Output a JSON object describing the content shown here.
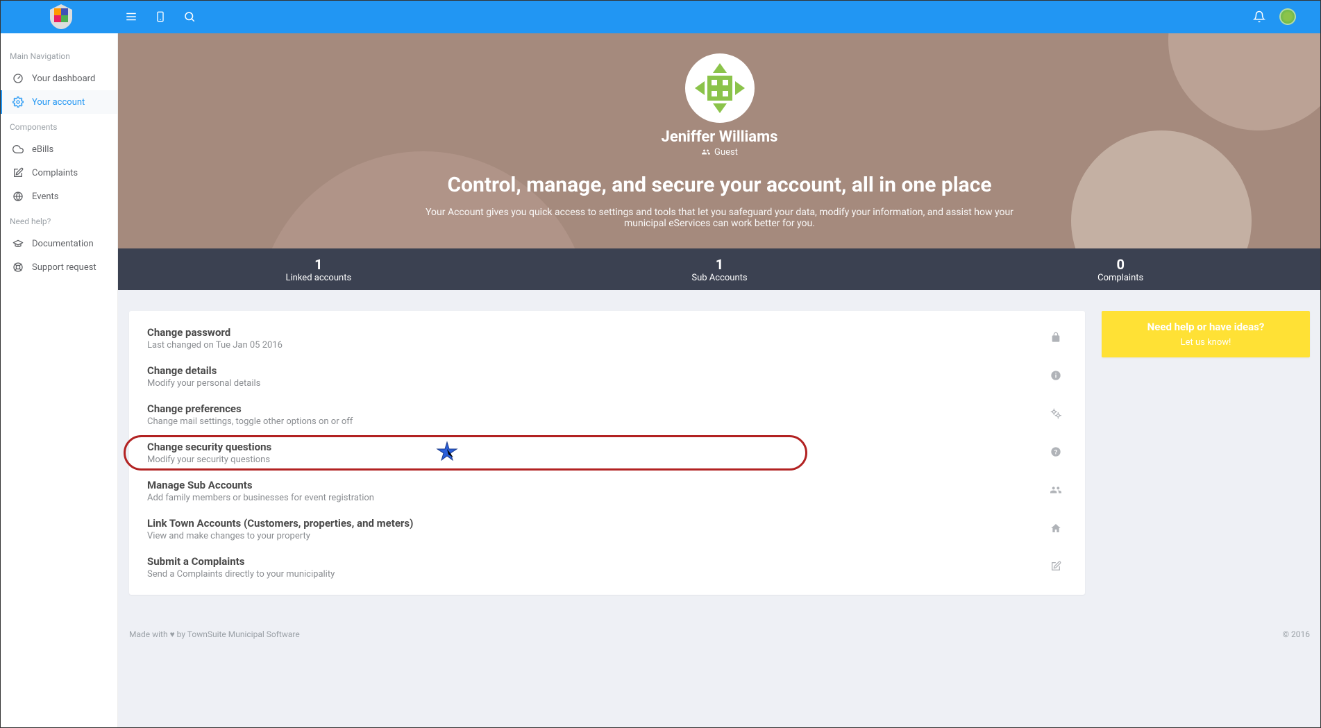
{
  "topbar": {
    "icons": [
      "menu",
      "mobile",
      "search"
    ],
    "right_icons": [
      "bell"
    ]
  },
  "sidebar": {
    "sections": [
      {
        "heading": "Main Navigation",
        "items": [
          {
            "label": "Your dashboard",
            "icon": "gauge",
            "active": false
          },
          {
            "label": "Your account",
            "icon": "gear",
            "active": true
          }
        ]
      },
      {
        "heading": "Components",
        "items": [
          {
            "label": "eBills",
            "icon": "cloud",
            "active": false
          },
          {
            "label": "Complaints",
            "icon": "edit",
            "active": false
          },
          {
            "label": "Events",
            "icon": "calendar-globe",
            "active": false
          }
        ]
      },
      {
        "heading": "Need help?",
        "items": [
          {
            "label": "Documentation",
            "icon": "grad-cap",
            "active": false
          },
          {
            "label": "Support request",
            "icon": "lifebuoy",
            "active": false
          }
        ]
      }
    ]
  },
  "hero": {
    "name": "Jeniffer Williams",
    "role": "Guest",
    "title": "Control, manage, and secure your account, all in one place",
    "subtitle": "Your Account gives you quick access to settings and tools that let you safeguard your data, modify your information, and assist how your municipal eServices can work better for you."
  },
  "stats": [
    {
      "value": "1",
      "label": "Linked accounts"
    },
    {
      "value": "1",
      "label": "Sub Accounts"
    },
    {
      "value": "0",
      "label": "Complaints"
    }
  ],
  "options": [
    {
      "title": "Change password",
      "desc": "Last changed on Tue Jan 05 2016",
      "icon": "lock",
      "highlighted": false
    },
    {
      "title": "Change details",
      "desc": "Modify your personal details",
      "icon": "info",
      "highlighted": false
    },
    {
      "title": "Change preferences",
      "desc": "Change mail settings, toggle other options on or off",
      "icon": "cogs",
      "highlighted": false
    },
    {
      "title": "Change security questions",
      "desc": "Modify your security questions",
      "icon": "question",
      "highlighted": true
    },
    {
      "title": "Manage Sub Accounts",
      "desc": "Add family members or businesses for event registration",
      "icon": "users",
      "highlighted": false
    },
    {
      "title": "Link Town Accounts (Customers, properties, and meters)",
      "desc": "View and make changes to your property",
      "icon": "home",
      "highlighted": false
    },
    {
      "title": "Submit a Complaints",
      "desc": "Send a Complaints directly to your municipality",
      "icon": "edit",
      "highlighted": false
    }
  ],
  "help_card": {
    "title": "Need help or have ideas?",
    "link": "Let us know!"
  },
  "footer": {
    "left_prefix": "Made with ",
    "left_suffix": " by ",
    "left_link": "TownSuite Municipal Software",
    "right": "© 2016"
  }
}
